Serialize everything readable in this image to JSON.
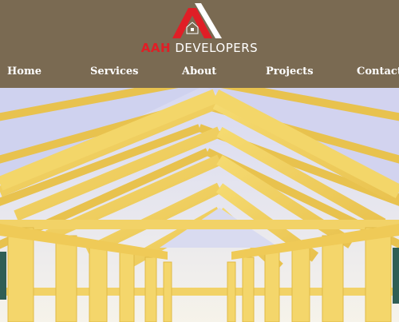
{
  "brand": {
    "name_accent": "AAH",
    "name_rest": "DEVELOPERS",
    "logo_icon": "house-a-logo-icon"
  },
  "nav": {
    "items": [
      {
        "label": "Home"
      },
      {
        "label": "Services"
      },
      {
        "label": "About"
      },
      {
        "label": "Projects"
      },
      {
        "label": "Contact"
      }
    ]
  },
  "hero": {
    "image": "yellow-timber-roof-trusses-photo"
  },
  "colors": {
    "header_bg": "#7a6a52",
    "brand_red": "#e01e26",
    "nav_text": "#ffffff",
    "timber_yellow": "#f2d267"
  }
}
